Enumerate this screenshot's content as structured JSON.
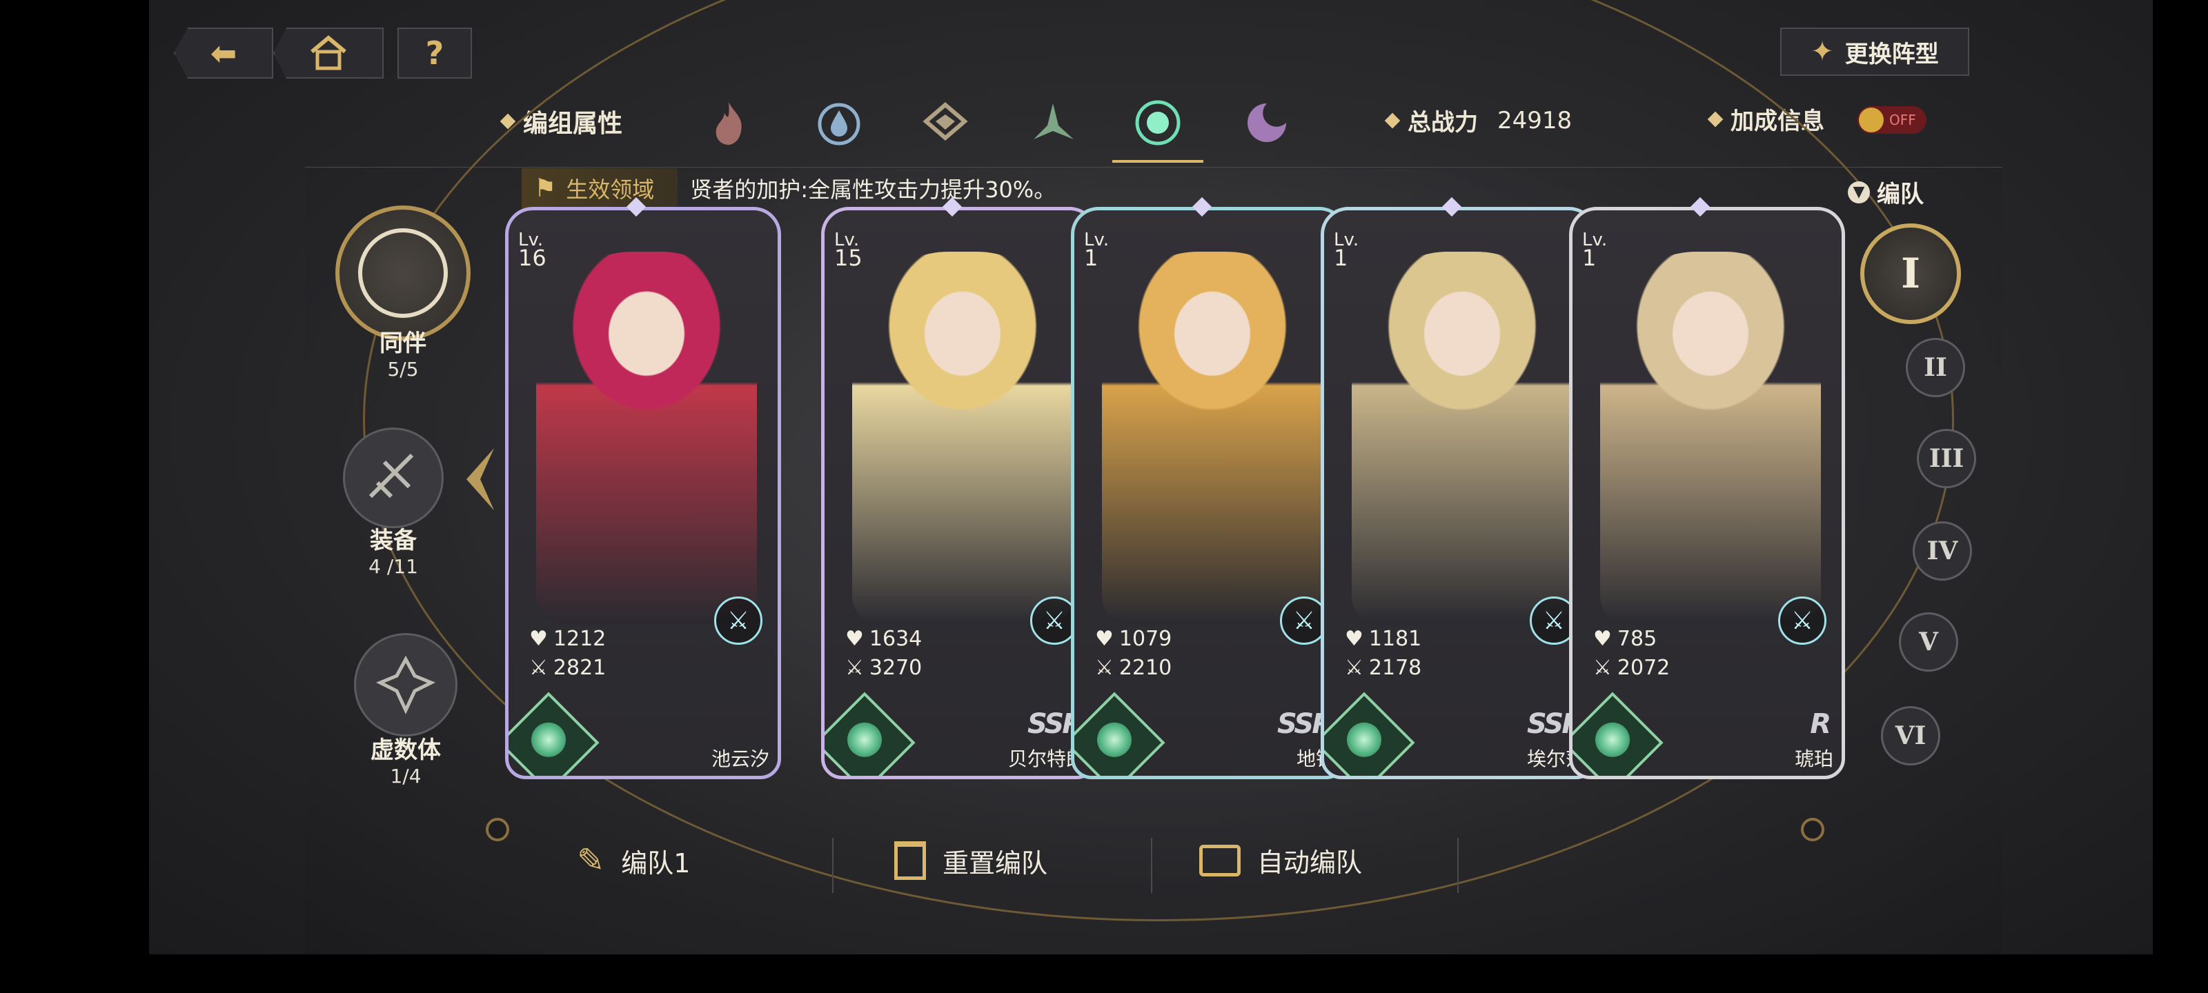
{
  "nav": {
    "back_icon": "back-arrow-icon",
    "home_icon": "home-icon",
    "help_label": "?"
  },
  "formation_button": {
    "label": "更换阵型",
    "icon": "formation-icon"
  },
  "attribute_bar": {
    "label": "编组属性",
    "elements": [
      {
        "name": "fire-element-icon",
        "active": false
      },
      {
        "name": "water-element-icon",
        "active": false
      },
      {
        "name": "earth-element-icon",
        "active": false
      },
      {
        "name": "wind-element-icon",
        "active": false
      },
      {
        "name": "light-element-icon",
        "active": true
      },
      {
        "name": "dark-element-icon",
        "active": false
      }
    ],
    "power_label": "总战力",
    "power_value": "24918",
    "bonus_label": "加成信息",
    "bonus_toggle": "OFF"
  },
  "effect": {
    "tag": "生效领域",
    "text": "贤者的加护:全属性攻击力提升30%。"
  },
  "team_label": "编队",
  "side_menu": [
    {
      "label": "同伴",
      "count": "5/5",
      "icon": "companion-icon",
      "active": true
    },
    {
      "label": "装备",
      "count": "4 /11",
      "icon": "equipment-icon",
      "active": false
    },
    {
      "label": "虚数体",
      "count": "1/4",
      "icon": "imaginary-icon",
      "active": false
    }
  ],
  "team_numbers": [
    "I",
    "II",
    "III",
    "IV",
    "V",
    "VI"
  ],
  "cards": [
    {
      "lv_label": "Lv.",
      "lv": "16",
      "hp": "1212",
      "atk": "2821",
      "rarity": "",
      "name": "池云汐",
      "color": "#c0384a",
      "hair": "#c1285a",
      "class_icon": "sword-class-icon"
    },
    {
      "lv_label": "Lv.",
      "lv": "15",
      "hp": "1634",
      "atk": "3270",
      "rarity": "SSR",
      "name": "贝尔特朗",
      "color": "#e9d7a0",
      "hair": "#e6c97c",
      "class_icon": "staff-class-icon"
    },
    {
      "lv_label": "Lv.",
      "lv": "1",
      "hp": "1079",
      "atk": "2210",
      "rarity": "SSR",
      "name": "地锦",
      "color": "#d9a24a",
      "hair": "#e4b25c",
      "class_icon": "mask-class-icon"
    },
    {
      "lv_label": "Lv.",
      "lv": "1",
      "hp": "1181",
      "atk": "2178",
      "rarity": "SSR",
      "name": "埃尔莎",
      "color": "#c9b58a",
      "hair": "#dcc690",
      "class_icon": "shield-class-icon"
    },
    {
      "lv_label": "Lv.",
      "lv": "1",
      "hp": "785",
      "atk": "2072",
      "rarity": "R",
      "name": "琥珀",
      "color": "#cdb48a",
      "hair": "#d9c39a",
      "class_icon": "sword-class-icon"
    }
  ],
  "bottom_actions": [
    {
      "label": "编队1",
      "icon": "feather-edit-icon"
    },
    {
      "label": "重置编队",
      "icon": "trash-icon"
    },
    {
      "label": "自动编队",
      "icon": "auto-monitor-icon"
    }
  ]
}
